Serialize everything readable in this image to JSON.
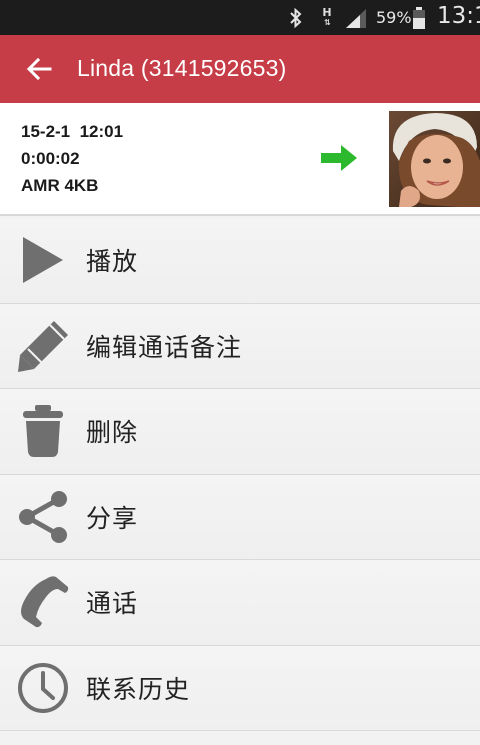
{
  "status_bar": {
    "network_type": "H",
    "battery_percent": "59%",
    "time": "13:1",
    "icons": [
      "bluetooth-icon",
      "network-h-icon",
      "signal-icon",
      "battery-icon"
    ]
  },
  "header": {
    "title": "Linda (3141592653)",
    "background_color": "#c63d47",
    "back_icon": "back-arrow-icon"
  },
  "recording": {
    "date_time": "15-2-1  12:01",
    "duration": "0:00:02",
    "format": "AMR 4KB",
    "direction_icon": "outgoing-arrow-icon",
    "direction_color": "#2db92d",
    "photo": "contact-photo"
  },
  "menu": {
    "items": [
      {
        "label": "播放",
        "icon": "play-icon"
      },
      {
        "label": "编辑通话备注",
        "icon": "pencil-icon"
      },
      {
        "label": "删除",
        "icon": "trash-icon"
      },
      {
        "label": "分享",
        "icon": "share-icon"
      },
      {
        "label": "通话",
        "icon": "phone-icon"
      },
      {
        "label": "联系历史",
        "icon": "clock-icon"
      }
    ],
    "icon_color": "#6f6f6f"
  }
}
